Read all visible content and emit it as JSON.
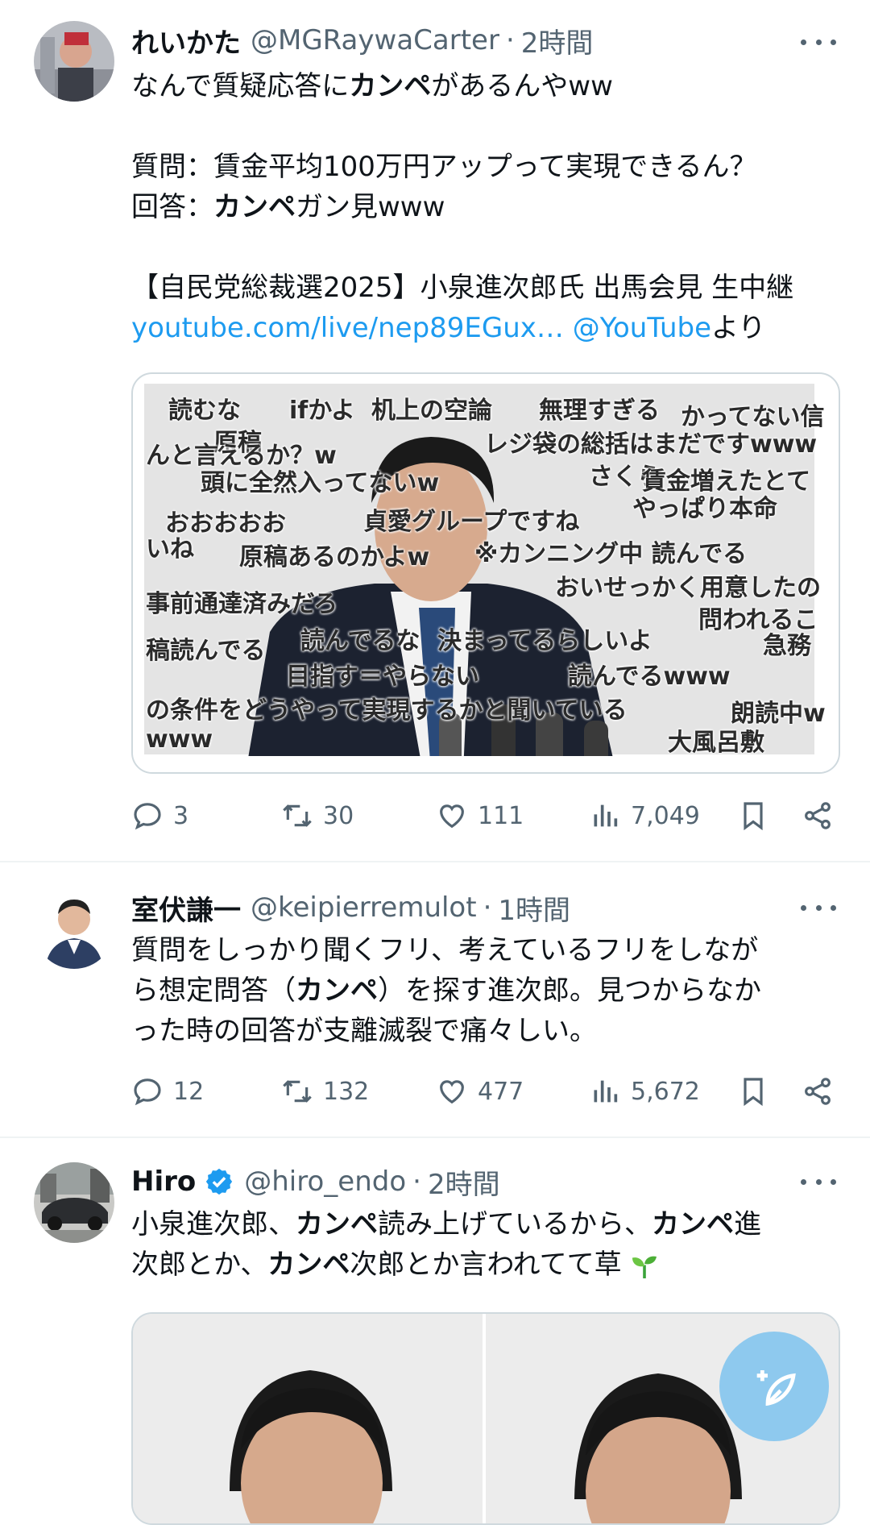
{
  "tweets": [
    {
      "name": "れいかた",
      "handle": "@MGRaywaCarter",
      "dot": "·",
      "time": "2時間",
      "text": {
        "l1a": "なんで質疑応答に",
        "l1b": "カンペ",
        "l1c": "があるんやww",
        "l2": "質問：賃金平均100万円アップって実現できるん？",
        "l3a": "回答：",
        "l3b": "カンペ",
        "l3c": "ガン見www",
        "l4": "【自民党総裁選2025】小泉進次郎氏 出馬会見 生中継",
        "link1": "youtube.com/live/nep89EGux…",
        "link2": "@YouTube",
        "l5tail": "より"
      },
      "media_comments": [
        "読むな",
        "ifかよ",
        "机上の空論",
        "無理すぎる",
        "かってない信",
        "原稿",
        "んと言えるか？w",
        "レジ袋の総括はまだですwww",
        "頭に全然入ってないw",
        "さくら",
        "賃金増えたとて",
        "やっぱり本命",
        "おおおおお",
        "貞愛グループですね",
        "原稿あるのかよw",
        "※カンニング中 読んでる",
        "いね",
        "おいせっかく用意したの",
        "事前通達済みだろ",
        "問われるこ",
        "稿読んでる",
        "読んでるな",
        "決まってるらしいよ",
        "急務",
        "目指す＝やらない",
        "読んでるwww",
        "の条件をどうやって実現するかと聞いている",
        "朗読中w",
        "www",
        "大風呂敷"
      ],
      "actions": {
        "reply": "3",
        "retweet": "30",
        "like": "111",
        "views": "7,049"
      }
    },
    {
      "name": "室伏謙一",
      "handle": "@keipierremulot",
      "dot": "·",
      "time": "1時間",
      "text": {
        "l1": "質問をしっかり聞くフリ、考えているフリをしなが",
        "l2a": "ら想定問答（",
        "l2b": "カンペ",
        "l2c": "）を探す進次郎。見つからなか",
        "l3": "った時の回答が支離滅裂で痛々しい。"
      },
      "actions": {
        "reply": "12",
        "retweet": "132",
        "like": "477",
        "views": "5,672"
      }
    },
    {
      "name": "Hiro",
      "handle": "@hiro_endo",
      "dot": "·",
      "time": "2時間",
      "text": {
        "l1a": "小泉進次郎、",
        "l1b": "カンペ",
        "l1c": "読み上げているから、",
        "l1d": "カンペ",
        "l1e": "進",
        "l2a": "次郎とか、",
        "l2b": "カンペ",
        "l2c": "次郎とか言われてて草"
      }
    }
  ],
  "icons": [
    "more-icon",
    "reply-icon",
    "retweet-icon",
    "like-icon",
    "views-icon",
    "bookmark-icon",
    "share-icon",
    "verified-icon",
    "compose-icon",
    "sprout-emoji"
  ],
  "colors": {
    "link": "#1d9bf0",
    "secondary": "#536471",
    "verified": "#1d9bf0",
    "fab": "#8ec9ee"
  }
}
